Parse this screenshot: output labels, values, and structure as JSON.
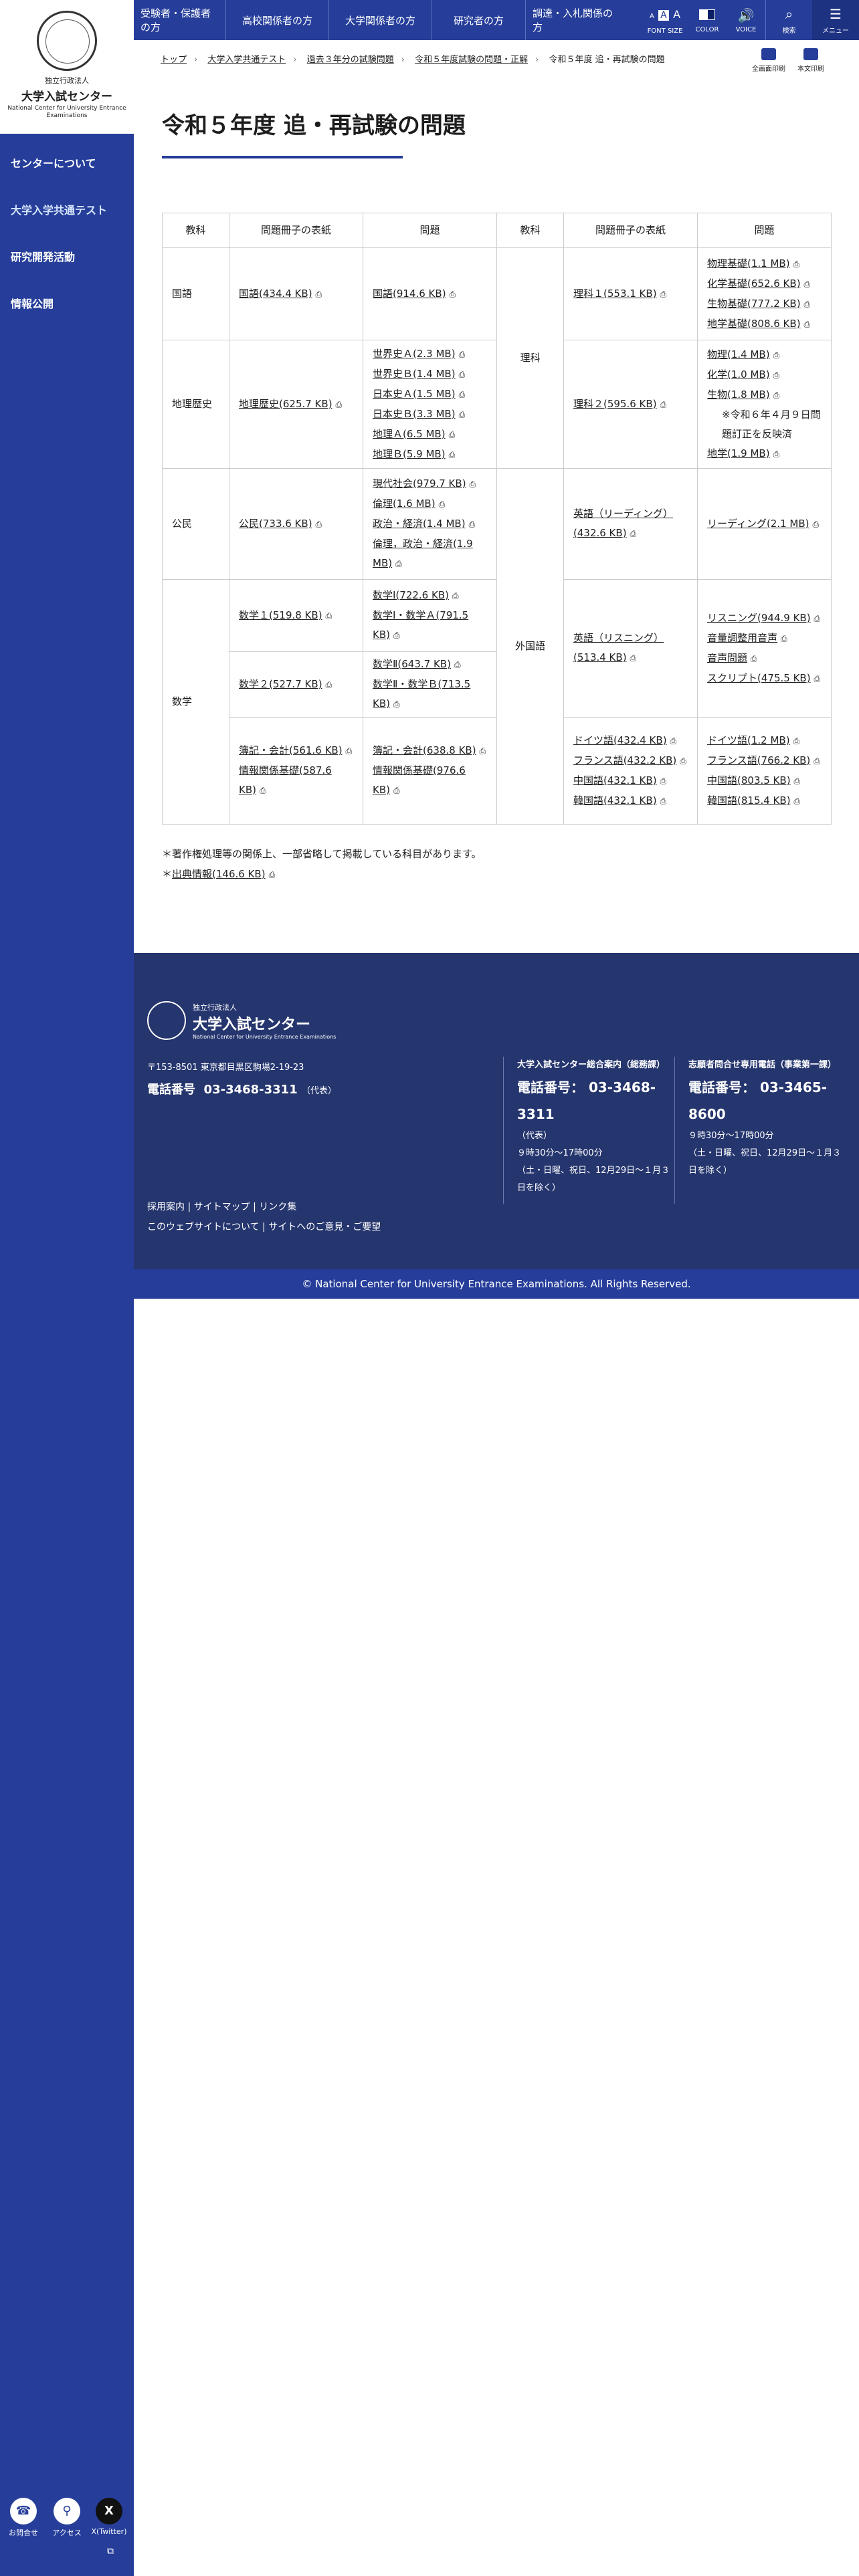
{
  "org": {
    "name_small": "独立行政法人",
    "name": "大学入試センター",
    "name_en": "National Center for University Entrance Examinations"
  },
  "sidenav": [
    "センターについて",
    "大学入学共通テスト",
    "研究開発活動",
    "情報公開"
  ],
  "sidebottom": [
    {
      "label": "お問合せ",
      "icon": "phone-icon"
    },
    {
      "label": "アクセス",
      "icon": "map-pin-icon"
    },
    {
      "label": "X(Twitter)",
      "icon": "x-icon"
    }
  ],
  "topnav": [
    "受験者・保護者の方",
    "高校関係者の方",
    "大学関係者の方",
    "研究者の方",
    "調達・入札関係の方"
  ],
  "tools": {
    "fontsize": "FONT SIZE",
    "color": "COLOR",
    "voice": "VOICE",
    "search": "検索",
    "menu": "メニュー",
    "font_a_small": "A",
    "font_a_big": "A"
  },
  "breadcrumb": [
    "トップ",
    "大学入学共通テスト",
    "過去３年分の試験問題",
    "令和５年度試験の問題・正解",
    "令和５年度 追・再試験の問題"
  ],
  "print": {
    "all": "全画面印刷",
    "body": "本文印刷"
  },
  "title": "令和５年度 追・再試験の問題",
  "table": {
    "headers": [
      "教科",
      "問題冊子の表紙",
      "問題",
      "教科",
      "問題冊子の表紙",
      "問題"
    ],
    "r1": {
      "subj": "国語",
      "cover": "国語(434.4 KB)",
      "q": "国語(914.6 KB)"
    },
    "rika": {
      "subj": "理科",
      "cover1": "理科１(553.1 KB)",
      "q1": [
        "物理基礎(1.1 MB)",
        "化学基礎(652.6 KB)",
        "生物基礎(777.2 KB)",
        "地学基礎(808.6 KB)"
      ],
      "cover2": "理科２(595.6 KB)",
      "q2": [
        "物理(1.4 MB)",
        "化学(1.0 MB)",
        "生物(1.8 MB)"
      ],
      "note": "※令和６年４月９日問題訂正を反映済",
      "q2b": "地学(1.9 MB)"
    },
    "r2": {
      "subj": "地理歴史",
      "cover": "地理歴史(625.7 KB)",
      "q": [
        "世界史Ａ(2.3 MB)",
        "世界史Ｂ(1.4 MB)",
        "日本史Ａ(1.5 MB)",
        "日本史Ｂ(3.3 MB)",
        "地理Ａ(6.5 MB)",
        "地理Ｂ(5.9 MB)"
      ]
    },
    "r3": {
      "subj": "公民",
      "cover": "公民(733.6 KB)",
      "q": [
        "現代社会(979.7 KB)",
        "倫理(1.6 MB)",
        "政治・経済(1.4 MB)",
        "倫理，政治・経済(1.9 MB)"
      ]
    },
    "gaikoku": {
      "subj": "外国語",
      "e1_cover": "英語（リーディング）(432.6 KB)",
      "e1_q": "リーディング(2.1 MB)",
      "e2_cover": "英語（リスニング）(513.4 KB)",
      "e2_q": [
        "リスニング(944.9 KB)",
        "音量調整用音声",
        "音声問題",
        "スクリプト(475.5 KB)"
      ],
      "o_cover": [
        "ドイツ語(432.4 KB)",
        "フランス語(432.2 KB)",
        "中国語(432.1 KB)",
        "韓国語(432.1 KB)"
      ],
      "o_q": [
        "ドイツ語(1.2 MB)",
        "フランス語(766.2 KB)",
        "中国語(803.5 KB)",
        "韓国語(815.4 KB)"
      ]
    },
    "r4": {
      "subj": "数学",
      "c1": "数学１(519.8 KB)",
      "q1": [
        "数学Ⅰ(722.6 KB)",
        "数学Ⅰ・数学Ａ(791.5 KB)"
      ],
      "c2": "数学２(527.7 KB)",
      "q2": [
        "数学Ⅱ(643.7 KB)",
        "数学Ⅱ・数学Ｂ(713.5 KB)"
      ],
      "c3": [
        "簿記・会計(561.6 KB)",
        "情報関係基礎(587.6 KB)"
      ],
      "q3": [
        "簿記・会計(638.8 KB)",
        "情報関係基礎(976.6 KB)"
      ]
    }
  },
  "notes": {
    "line1": "＊著作権処理等の関係上、一部省略して掲載している科目があります。",
    "line2_prefix": "＊",
    "line2_link": "出典情報(146.6 KB)"
  },
  "footer": {
    "address": "〒153-8501 東京都目黒区駒場2-19-23",
    "tel_label": "電話番号",
    "tel": "03-3468-3311",
    "tel_note": "（代表）",
    "links1": [
      "採用案内",
      "サイトマップ",
      "リンク集"
    ],
    "links2": [
      "このウェブサイトについて",
      "サイトへのご意見・ご要望"
    ],
    "c1": {
      "title": "大学入試センター総合案内（総務課）",
      "tel_label": "電話番号：",
      "tel": "03-3468-3311",
      "note": "（代表）",
      "hours": "９時30分～17時00分",
      "days": "（土・日曜、祝日、12月29日～１月３日を除く）"
    },
    "c2": {
      "title": "志願者問合せ専用電話（事業第一課）",
      "tel_label": "電話番号：",
      "tel": "03-3465-8600",
      "hours": "９時30分～17時00分",
      "days": "（土・日曜、祝日、12月29日～１月３日を除く）"
    }
  },
  "copyright": "© National Center for University Entrance Examinations. All Rights Reserved.",
  "pdf_icon": "pdf-icon"
}
